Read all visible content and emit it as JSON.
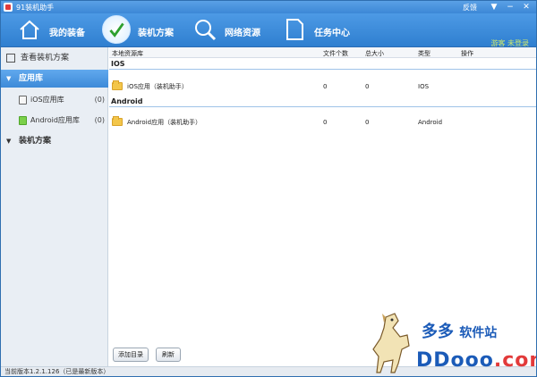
{
  "titlebar": {
    "title": "91装机助手",
    "feedback": "反馈",
    "menu_glyph": "▼",
    "min_glyph": "−",
    "close_glyph": "✕"
  },
  "toolbar": {
    "items": [
      {
        "label": "我的装备",
        "icon": "home-icon"
      },
      {
        "label": "装机方案",
        "icon": "check-icon"
      },
      {
        "label": "网络资源",
        "icon": "search-icon"
      },
      {
        "label": "任务中心",
        "icon": "document-icon"
      }
    ],
    "login": "游客 未登录"
  },
  "sidebar": {
    "view_plan": "查看装机方案",
    "library": "应用库",
    "library_arrow": "▼",
    "ios_library": {
      "label": "iOS应用库",
      "count": "(0)"
    },
    "android_library": {
      "label": "Android应用库",
      "count": "(0)"
    },
    "plan": "装机方案",
    "plan_arrow": "▼"
  },
  "table": {
    "headers": [
      "本地资源库",
      "文件个数",
      "总大小",
      "类型",
      "操作"
    ],
    "groups": [
      {
        "name": "IOS",
        "row": {
          "name": "iOS应用（装机助手）",
          "files": "0",
          "size": "0",
          "type": "IOS"
        }
      },
      {
        "name": "Android",
        "row": {
          "name": "Android应用（装机助手）",
          "files": "0",
          "size": "0",
          "type": "Android"
        }
      }
    ]
  },
  "buttons": {
    "add": "添加目录",
    "refresh": "刷新"
  },
  "status": "当前版本1.2.1.126（已是最新版本）",
  "watermark": {
    "cn_main": "多多",
    "cn_sub": "软件站",
    "url_main": "DDooo",
    "url_dot": ".com"
  },
  "colors": {
    "toolbar": "#3c87d6",
    "selected": "#3d8ad8",
    "watermark": "#1b5bb8"
  }
}
